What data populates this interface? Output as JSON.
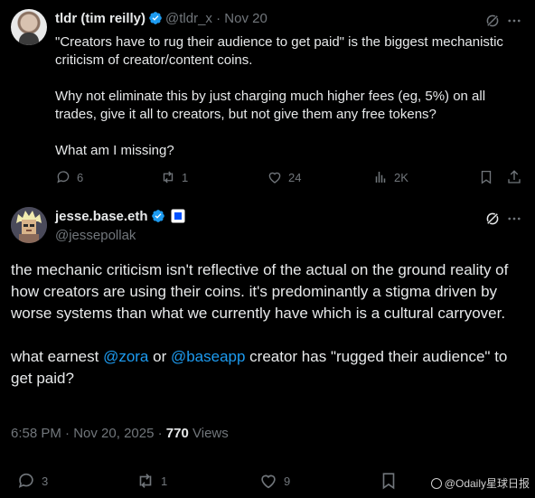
{
  "tweet1": {
    "author_name": "tldr (tim reilly)",
    "handle": "@tldr_x",
    "separator": "·",
    "date": "Nov 20",
    "paragraphs": [
      "\"Creators have to rug their audience to get paid\" is the biggest mechanistic criticism of creator/content coins.",
      "Why not eliminate this by just charging much higher fees (eg, 5%) on all trades, give it all to creators, but not give them any free tokens?",
      "What am I missing?"
    ],
    "actions": {
      "replies": "6",
      "reposts": "1",
      "likes": "24",
      "views": "2K"
    }
  },
  "tweet2": {
    "author_name": "jesse.base.eth",
    "handle": "@jessepollak",
    "paragraph1": "the mechanic criticism isn't reflective of the actual on the ground reality of how creators are using their coins. it's predominantly a stigma driven by worse systems than what we currently have which is a cultural carryover.",
    "paragraph2_before": "what earnest ",
    "mention1": "@zora",
    "paragraph2_middle": " or ",
    "mention2": "@baseapp",
    "paragraph2_after": " creator has \"rugged their audience\" to get paid?",
    "time": "6:58 PM",
    "date": "Nov 20, 2025",
    "views_count": "770",
    "views_label": "Views",
    "actions": {
      "replies": "3",
      "reposts": "1",
      "likes": "9"
    }
  },
  "watermark": "@Odaily星球日报",
  "colors": {
    "background": "#000000",
    "text": "#e7e9ea",
    "muted": "#71767b",
    "accent": "#1d9bf0"
  }
}
